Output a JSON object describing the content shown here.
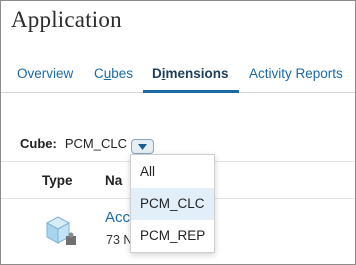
{
  "header": {
    "title": "Application"
  },
  "tabs": [
    {
      "pre": "Overview",
      "u": "",
      "post": ""
    },
    {
      "pre": "C",
      "u": "u",
      "post": "bes"
    },
    {
      "pre": "D",
      "u": "i",
      "post": "mensions"
    },
    {
      "pre": "Activity Reports",
      "u": "",
      "post": ""
    }
  ],
  "active_tab_index": 2,
  "cube_selector": {
    "label": "Cube:",
    "value": "PCM_CLC",
    "icon": "chevron-down-icon"
  },
  "table": {
    "columns": [
      "Type",
      "Na"
    ],
    "rows": [
      {
        "name": "Acc",
        "sub": "73 N",
        "icon": "cube-icon"
      }
    ]
  },
  "dropdown": {
    "options": [
      "All",
      "PCM_CLC",
      "PCM_REP"
    ],
    "highlighted": "PCM_CLC"
  },
  "colors": {
    "link": "#1a6aa5",
    "active_tab": "#1f3e5a",
    "highlight": "#e2eef8",
    "icon_body": "#a8d4f0"
  }
}
